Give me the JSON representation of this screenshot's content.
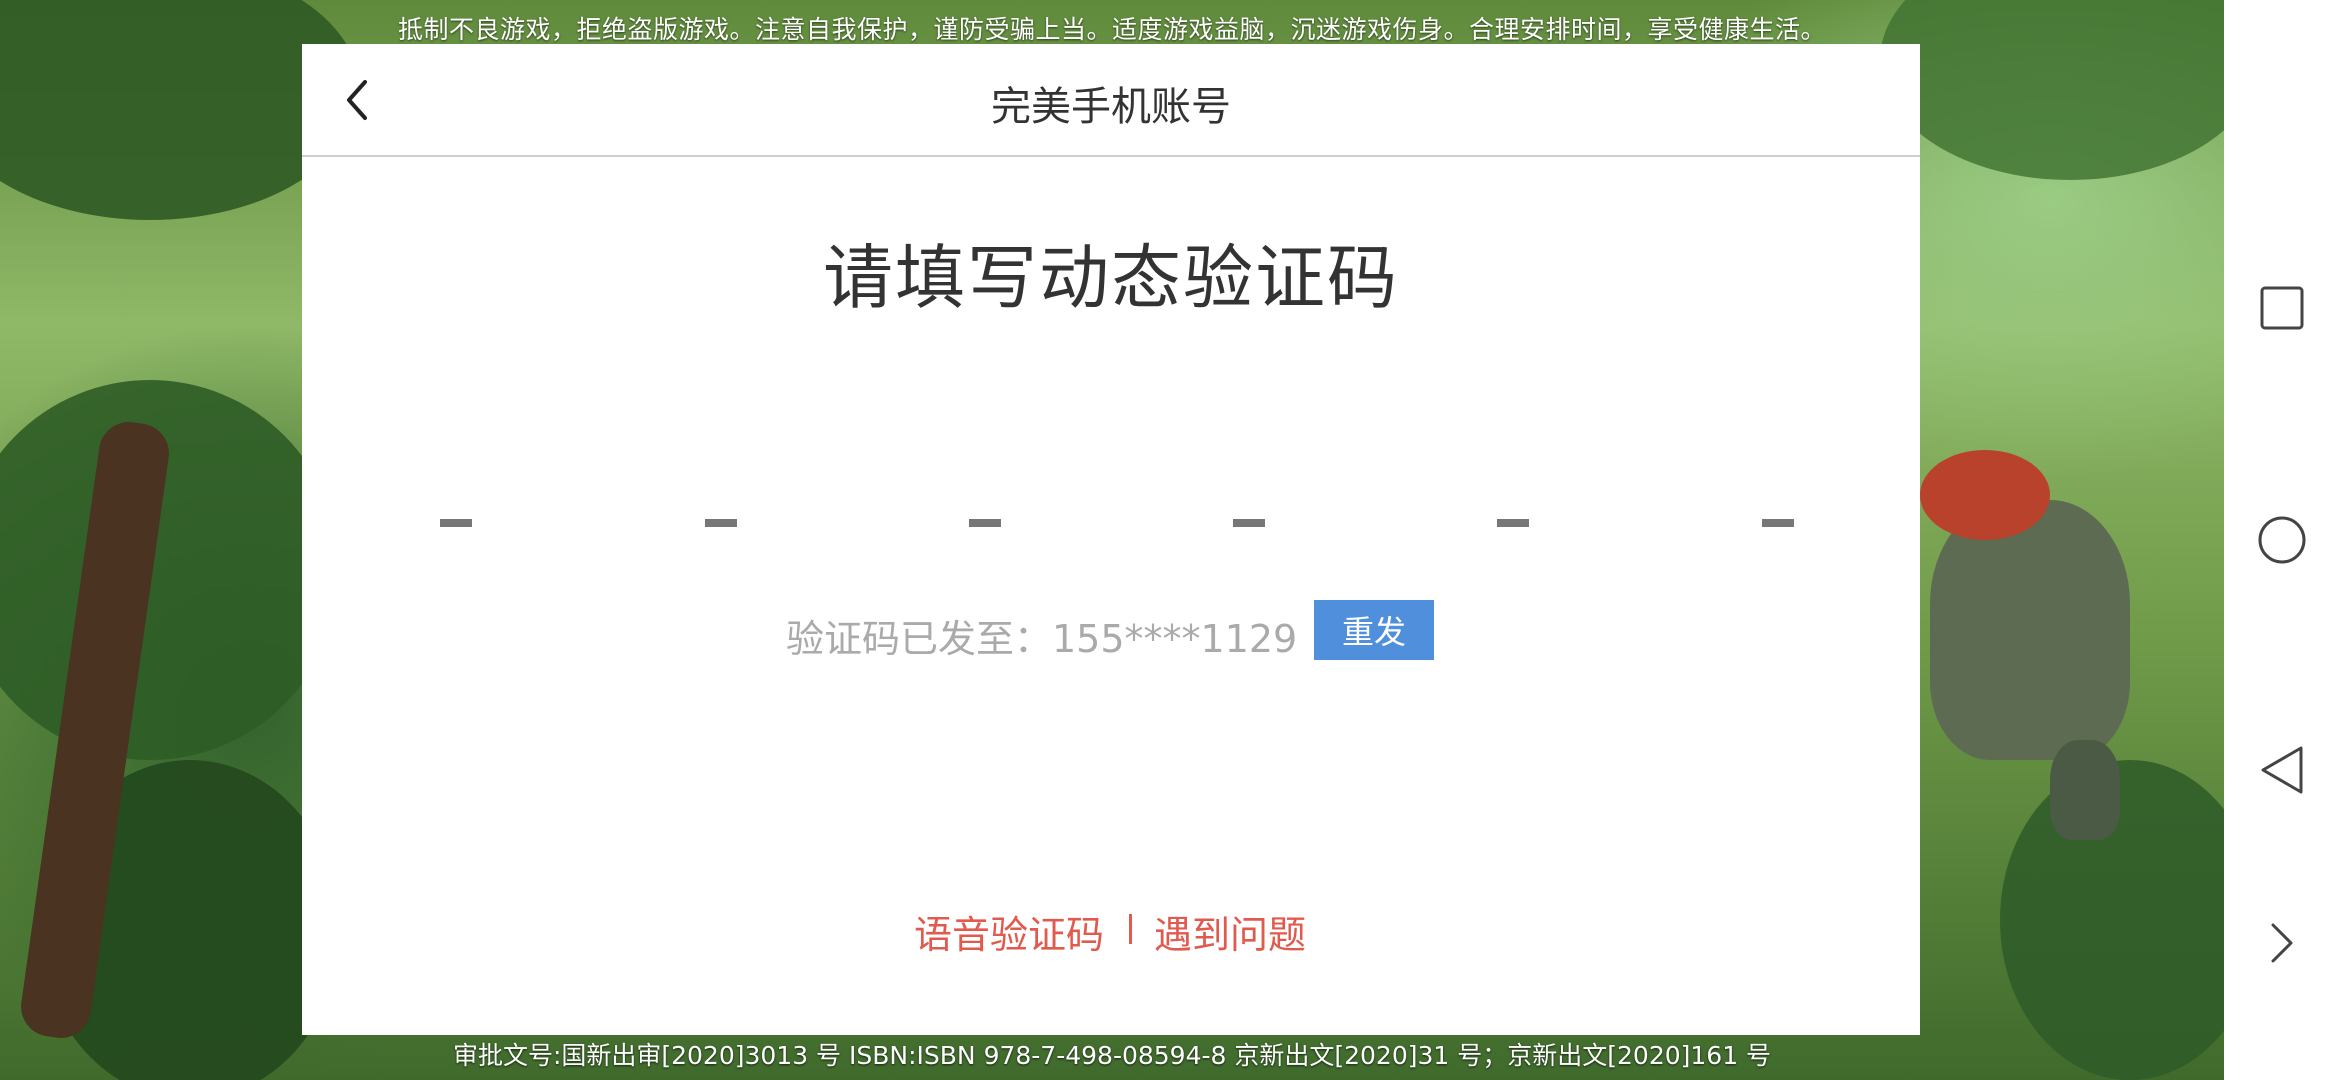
{
  "banner": {
    "top_warning": "抵制不良游戏，拒绝盗版游戏。注意自我保护，谨防受骗上当。适度游戏益脑，沉迷游戏伤身。合理安排时间，享受健康生活。",
    "bottom_info": "审批文号:国新出审[2020]3013 号 ISBN:ISBN 978-7-498-08594-8 京新出文[2020]31 号；京新出文[2020]161 号"
  },
  "dialog": {
    "title": "完美手机账号",
    "heading": "请填写动态验证码",
    "code_length": 6,
    "sent_label": "验证码已发至：155****1129",
    "resend_label": "重发",
    "voice_code_link": "语音验证码",
    "help_link": "遇到问题",
    "icons": {
      "back": "chevron-left-icon"
    },
    "colors": {
      "resend_bg": "#4f8fdc",
      "link": "#e05a4e"
    }
  },
  "navbar": {
    "icons": [
      "square-recents-icon",
      "circle-home-icon",
      "triangle-back-icon",
      "chevron-right-icon"
    ]
  }
}
